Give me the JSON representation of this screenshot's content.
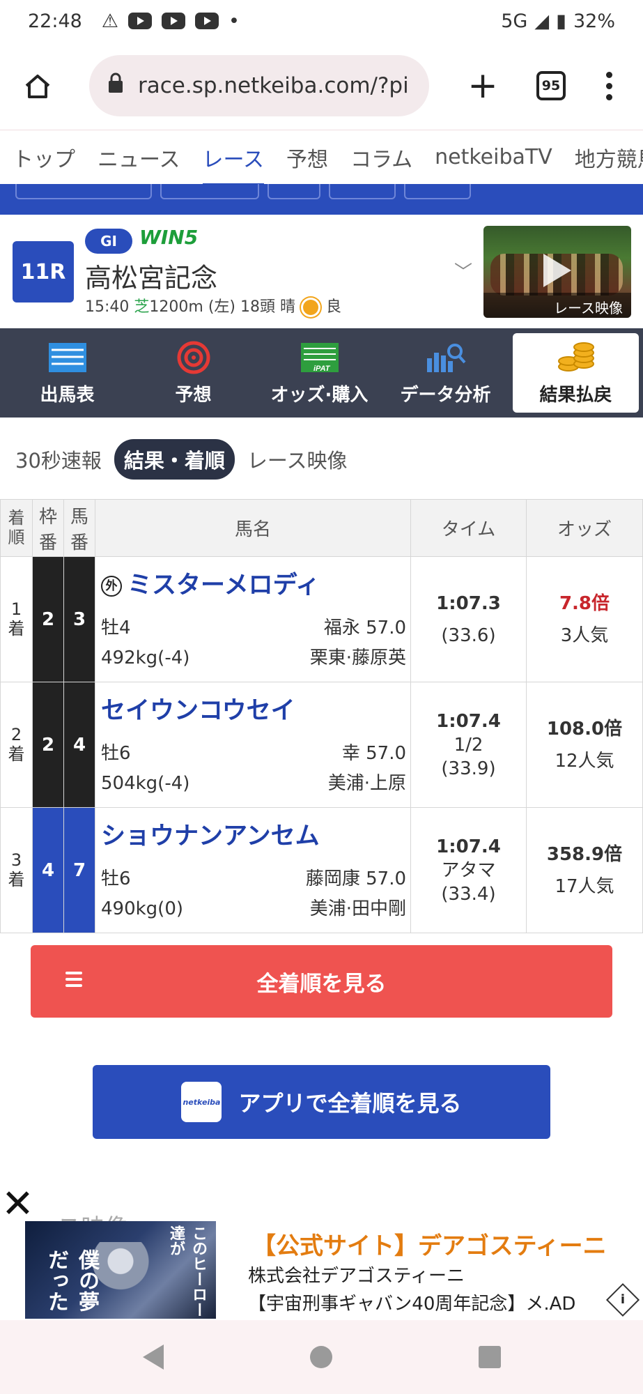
{
  "status": {
    "time": "22:48",
    "network": "5G",
    "battery": "32%"
  },
  "browser": {
    "url": "race.sp.netkeiba.com/?pi",
    "tab_count": "95"
  },
  "site_nav": [
    "トップ",
    "ニュース",
    "レース",
    "予想",
    "コラム",
    "netkeibaTV",
    "地方競馬"
  ],
  "race": {
    "number": "11R",
    "grade": "GI",
    "win5": "WIN5",
    "name": "高松宮記念",
    "time": "15:40",
    "surface": "芝",
    "detail": "1200m (左) 18頭 晴",
    "condition": "良",
    "video_caption": "レース映像"
  },
  "toolbar": [
    "出馬表",
    "予想",
    "オッズ·購入",
    "データ分析",
    "結果払戻"
  ],
  "subtabs": [
    "30秒速報",
    "結果・着順",
    "レース映像"
  ],
  "table": {
    "headers": {
      "pos_a": "着",
      "pos_b": "順",
      "waku_a": "枠",
      "waku_b": "番",
      "uma_a": "馬",
      "uma_b": "番",
      "name": "馬名",
      "time": "タイム",
      "odds": "オッズ"
    },
    "rows": [
      {
        "pos": "1",
        "pos_suffix": "着",
        "waku": "2",
        "uma": "3",
        "foreign": "外",
        "name": "ミスターメロディ",
        "sexage": "牡4",
        "jockey": "福永 57.0",
        "weight": "492kg(-4)",
        "trainer": "栗東·藤原英",
        "time": "1:07.3",
        "margin": "",
        "last3f": "(33.6)",
        "odds": "7.8倍",
        "pop": "3人気"
      },
      {
        "pos": "2",
        "pos_suffix": "着",
        "waku": "2",
        "uma": "4",
        "foreign": "",
        "name": "セイウンコウセイ",
        "sexage": "牡6",
        "jockey": "幸 57.0",
        "weight": "504kg(-4)",
        "trainer": "美浦·上原",
        "time": "1:07.4",
        "margin": "1/2",
        "last3f": "(33.9)",
        "odds": "108.0倍",
        "pop": "12人気"
      },
      {
        "pos": "3",
        "pos_suffix": "着",
        "waku": "4",
        "uma": "7",
        "foreign": "",
        "name": "ショウナンアンセム",
        "sexage": "牡6",
        "jockey": "藤岡康 57.0",
        "weight": "490kg(0)",
        "trainer": "美浦·田中剛",
        "time": "1:07.4",
        "margin": "アタマ",
        "last3f": "(33.4)",
        "odds": "358.9倍",
        "pop": "17人気"
      }
    ]
  },
  "buttons": {
    "all_results": "全着順を見る",
    "app_results": "アプリで全着順を見る",
    "app_logo": "netkeiba"
  },
  "ad": {
    "title": "【公式サイト】デアゴスティーニ",
    "company": "株式会社デアゴスティーニ",
    "desc": "【宇宙刑事ギャバン40周年記念】メ.AD",
    "image_text_a": "このヒーロー達が",
    "image_text_b": "僕の夢だった",
    "behind_text": "ース映像"
  },
  "colors": {
    "brand_blue": "#2a4dbb",
    "red_button": "#ef5350",
    "ad_orange": "#e37c10",
    "odds_red": "#c8262c"
  }
}
